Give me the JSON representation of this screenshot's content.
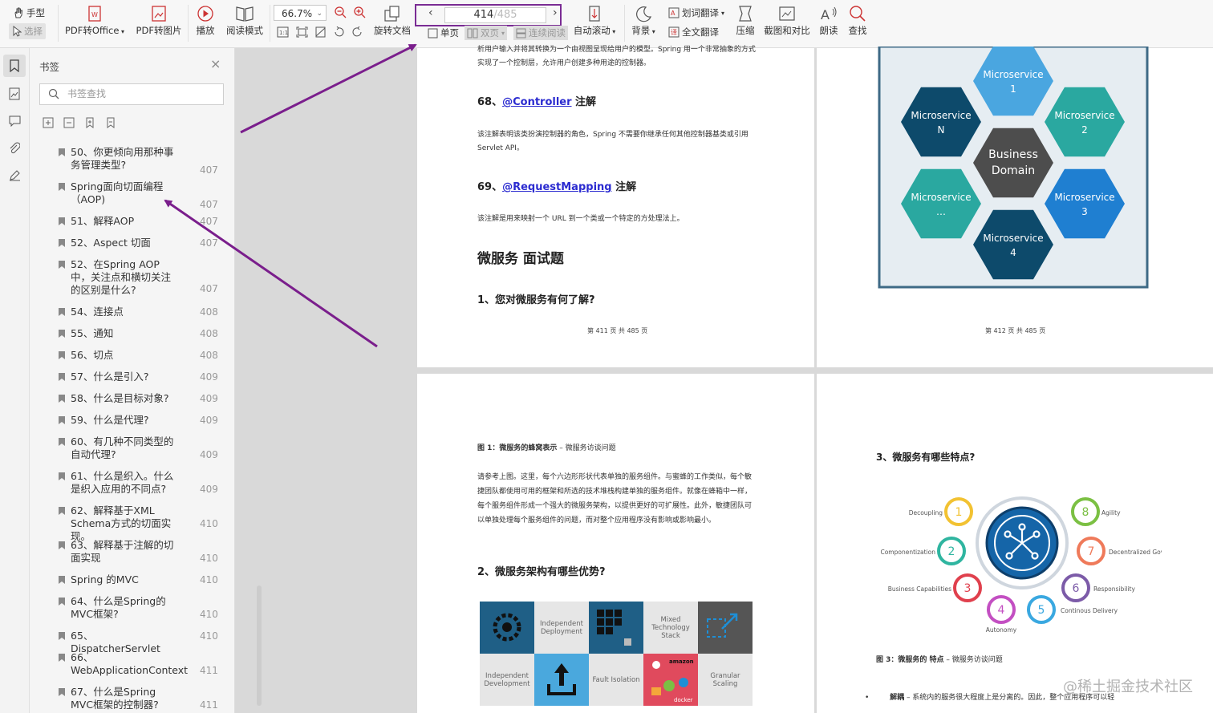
{
  "toolbar": {
    "hand_label": "手型",
    "select_label": "选择",
    "pdf_office_label": "PDF转Office",
    "pdf_image_label": "PDF转图片",
    "play_label": "播放",
    "read_mode_label": "阅读模式",
    "zoom_value": "66.7%",
    "rotate_label": "旋转文档",
    "page_current": "414",
    "page_total": "/485",
    "single_label": "单页",
    "double_label": "双页",
    "continuous_label": "连续阅读",
    "autoscroll_label": "自动滚动",
    "background_label": "背景",
    "word_translate_label": "划词翻译",
    "full_translate_label": "全文翻译",
    "compress_label": "压缩",
    "screenshot_label": "截图和对比",
    "read_aloud_label": "朗读",
    "find_label": "查找"
  },
  "sidebar": {
    "title": "书签",
    "search_placeholder": "书签查找",
    "items": [
      {
        "text": "50、你更倾向用那种事务管理类型?",
        "page": "407"
      },
      {
        "text": "Spring面向切面编程（AOP)",
        "page": "407"
      },
      {
        "text": "51、解释AOP",
        "page": "407"
      },
      {
        "text": "52、Aspect 切面",
        "page": "407"
      },
      {
        "text": "52、在Spring AOP 中，关注点和横切关注的区别是什么?",
        "page": "407"
      },
      {
        "text": "54、连接点",
        "page": "408"
      },
      {
        "text": "55、通知",
        "page": "408"
      },
      {
        "text": "56、切点",
        "page": "408"
      },
      {
        "text": "57、什么是引入?",
        "page": "409"
      },
      {
        "text": "58、什么是目标对象?",
        "page": "409"
      },
      {
        "text": "59、什么是代理?",
        "page": "409"
      },
      {
        "text": "60、有几种不同类型的自动代理?",
        "page": "409"
      },
      {
        "text": "61、什么是织入。什么是织入应用的不同点?",
        "page": "409"
      },
      {
        "text": "62、解释基于XML Schema方式的切面实现。",
        "page": "410"
      },
      {
        "text": "63、解释基于注解的切面实现",
        "page": "410"
      },
      {
        "text": "Spring 的MVC",
        "page": "410"
      },
      {
        "text": "64、什么是Spring的MVC框架?",
        "page": "410"
      },
      {
        "text": "65、DispatcherServlet",
        "page": "410"
      },
      {
        "text": "66、WebApplicationContext",
        "page": "411"
      },
      {
        "text": "67、什么是Spring MVC框架的控制器?",
        "page": "411"
      }
    ]
  },
  "page411": {
    "intro": "析用户输入并将其转换为一个由视图呈现给用户的模型。Spring 用一个非常抽象的方式实现了一个控制层，允许用户创建多种用途的控制器。",
    "h68_num": "68、",
    "h68_link": "@Controller",
    "h68_suffix": " 注解",
    "p68": "该注解表明该类扮演控制器的角色，Spring 不需要你继承任何其他控制器基类或引用 Servlet API。",
    "h69_num": "69、",
    "h69_link": "@RequestMapping",
    "h69_suffix": " 注解",
    "p69": "该注解是用来映射一个 URL 到一个类或一个特定的方处理法上。",
    "section": "微服务  面试题",
    "q1": "1、您对微服务有何了解?",
    "footer": "第 411 页 共 485 页"
  },
  "page412": {
    "center_line1": "Business",
    "center_line2": "Domain",
    "hex_labels": [
      {
        "line1": "Microservice",
        "line2": "1"
      },
      {
        "line1": "Microservice",
        "line2": "2"
      },
      {
        "line1": "Microservice",
        "line2": "3"
      },
      {
        "line1": "Microservice",
        "line2": "4"
      },
      {
        "line1": "Microservice",
        "line2": "…"
      },
      {
        "line1": "Microservice",
        "line2": "N"
      }
    ],
    "footer": "第 412 页 共 485 页"
  },
  "page413": {
    "caption_bold": "图 1：微服务的蜂窝表示",
    "caption_rest": " –  微服务访谈问题",
    "para": "请参考上图。这里，每个六边形形状代表单独的服务组件。与蜜蜂的工作类似，每个敏捷团队都使用可用的框架和所选的技术堆栈构建单独的服务组件。就像在蜂箱中一样，每个服务组件形成一个强大的微服务架构，以提供更好的可扩展性。此外，敏捷团队可以单独处理每个服务组件的问题，而对整个应用程序没有影响或影响最小。",
    "q2": "2、微服务架构有哪些优势?",
    "tiles": [
      "Independent Deployment",
      "Mixed Technology Stack",
      "Independent Development",
      "Fault Isolation",
      "Granular Scaling"
    ],
    "amazon": "amazon",
    "docker": "docker"
  },
  "page414": {
    "q3": "3、微服务有哪些特点?",
    "features": [
      {
        "n": "1",
        "label": "Decoupling",
        "color": "#f2c232"
      },
      {
        "n": "2",
        "label": "Componentization",
        "color": "#2fb5a0"
      },
      {
        "n": "3",
        "label": "Business Capabilities",
        "color": "#e0404d"
      },
      {
        "n": "4",
        "label": "Autonomy",
        "color": "#c34fc2"
      },
      {
        "n": "5",
        "label": "Continous Delivery",
        "color": "#3aa8e0"
      },
      {
        "n": "6",
        "label": "Responsibility",
        "color": "#7c5ba8"
      },
      {
        "n": "7",
        "label": "Decentralized Governance",
        "color": "#ef7a5a"
      },
      {
        "n": "8",
        "label": "Agility",
        "color": "#7bc043"
      }
    ],
    "caption_bold": "图 3：微服务的  特点",
    "caption_rest": " –  微服务访谈问题",
    "bullet_bold": "解耦",
    "bullet_rest": " – 系统内的服务很大程度上是分离的。因此，整个应用程序可以轻"
  },
  "watermark": "@稀土掘金技术社区",
  "colors": {
    "arrow": "#7a1e8c",
    "hex_dark": "#0d4a6b",
    "hex_teal": "#2aa8a0",
    "hex_blue": "#1f7fd1",
    "hex_light": "#4aa6e0",
    "hex_center": "#4d4d4d"
  }
}
